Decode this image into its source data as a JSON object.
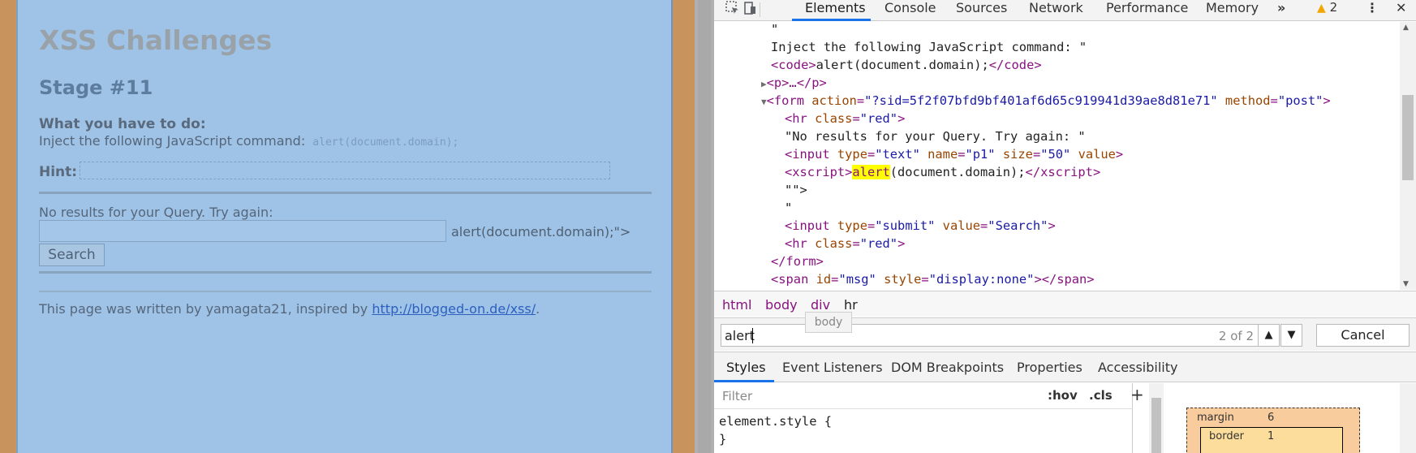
{
  "page": {
    "title": "XSS Challenges",
    "stage": "Stage #11",
    "todo_label": "What you have to do:",
    "inject_text": "Inject the following JavaScript command:",
    "inject_code": "alert(document.domain);",
    "hint_label": "Hint:",
    "no_results": "No results for your Query. Try again:",
    "query_value": "",
    "after_input": "alert(document.domain);\">",
    "search_button": "Search",
    "footer_text": "This page was written by yamagata21, inspired by",
    "footer_link": "http://blogged-on.de/xss/",
    "footer_end": "."
  },
  "devtools": {
    "tabs": [
      "Elements",
      "Console",
      "Sources",
      "Network",
      "Performance",
      "Memory"
    ],
    "more": "»",
    "warnings": "2",
    "dom_lines": {
      "l1": "\"",
      "l2": "Inject the following JavaScript command: \"",
      "l3_open": "<code>",
      "l3_text": "alert(document.domain);",
      "l3_close": "</code>",
      "l4": "<p>…</p>",
      "l5_tag": "<form",
      "l5_action_attr": "action",
      "l5_action_val": "\"?sid=5f2f07bfd9bf401af6d65c919941d39ae8d81e71\"",
      "l5_method_attr": "method",
      "l5_method_val": "\"post\"",
      "l6_tag": "<hr",
      "l6_attr": "class",
      "l6_val": "\"red\"",
      "l7": "\"No results for your Query. Try again: \"",
      "l8_tag": "<input",
      "l8_type_attr": "type",
      "l8_type_val": "\"text\"",
      "l8_name_attr": "name",
      "l8_name_val": "\"p1\"",
      "l8_size_attr": "size",
      "l8_size_val": "\"50\"",
      "l8_value_attr": "value",
      "l9_open": "<xscript>",
      "l9_hl": "alert",
      "l9_rest": "(document.domain);",
      "l9_close": "</xscript>",
      "l10": "\"\">",
      "l11": "\"",
      "l12_tag": "<input",
      "l12_type_attr": "type",
      "l12_type_val": "\"submit\"",
      "l12_value_attr": "value",
      "l12_value_val": "\"Search\"",
      "l13_tag": "<hr",
      "l13_attr": "class",
      "l13_val": "\"red\"",
      "l14": "</form>",
      "l15_tag": "<span",
      "l15_id_attr": "id",
      "l15_id_val": "\"msg\"",
      "l15_style_attr": "style",
      "l15_style_val": "\"display:none\"",
      "l15_close": "></span>"
    },
    "breadcrumbs": [
      "html",
      "body",
      "div",
      "hr"
    ],
    "tooltip": "body",
    "search": {
      "value": "alert",
      "count": "2 of 2",
      "cancel": "Cancel"
    },
    "subtabs": [
      "Styles",
      "Event Listeners",
      "DOM Breakpoints",
      "Properties",
      "Accessibility"
    ],
    "filter_placeholder": "Filter",
    "hov": ":hov",
    "cls": ".cls",
    "rule_open": "element.style {",
    "rule_close": "}",
    "box_model": {
      "margin_label": "margin",
      "margin_value": "6",
      "border_label": "border",
      "border_value": "1"
    }
  }
}
